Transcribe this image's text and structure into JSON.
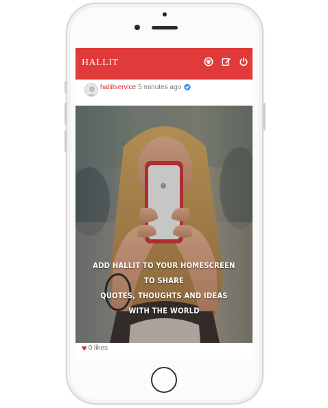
{
  "app": {
    "title": "HALLIT"
  },
  "appbar": {
    "icons": [
      "eye-icon",
      "edit-icon",
      "power-icon"
    ],
    "brand_color": "#e03a3a"
  },
  "post": {
    "username": "hallitservice",
    "time": "5 minutes ago",
    "verified_icon": "verified-badge-icon",
    "image_text": [
      "ADD HALLIT TO YOUR HOMESCREEN TO SHARE",
      "QUOTES, THOUGHTS AND IDEAS",
      "WITH THE WORLD"
    ],
    "likes": "0 likes",
    "like_icon": "heart-icon",
    "accent": "#d52f2f"
  }
}
